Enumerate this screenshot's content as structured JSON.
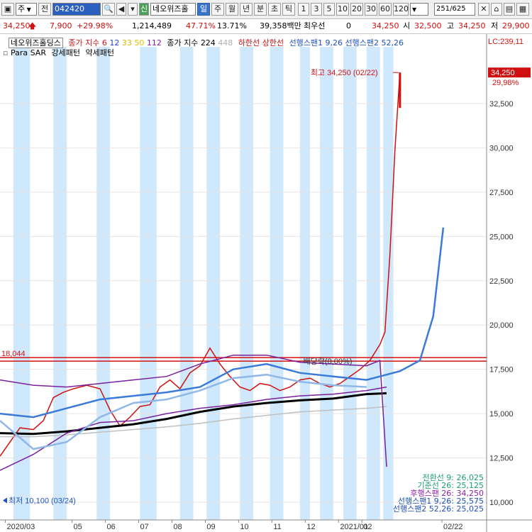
{
  "toolbar": {
    "period_type": "주",
    "prev_label": "전",
    "code": "042420",
    "new_badge": "신",
    "stock_name": "네오위즈홀",
    "periods": [
      "일",
      "주",
      "월",
      "년",
      "분",
      "초",
      "틱"
    ],
    "active_period": "일",
    "intervals": [
      "1",
      "3",
      "5",
      "10",
      "20",
      "30",
      "60",
      "120"
    ],
    "page": "251",
    "total": "/625"
  },
  "quote": {
    "price": "34,250",
    "change": "7,900",
    "change_pct": "+29.98%",
    "volume": "1,214,489",
    "ratio1": "47.71%",
    "ratio2": "13.71%",
    "amount": "39,358백만",
    "bid_label": "최우선",
    "bid_value": "0",
    "last": "34,250",
    "open_label": "시",
    "open": "32,500",
    "high_label": "고",
    "high": "34,250",
    "low_label": "저",
    "low": "29,900"
  },
  "legend": {
    "name": "네오위즈홀딩스",
    "ma_label": "종가 지수",
    "ma_periods": [
      "6",
      "12",
      "33",
      "50",
      "112"
    ],
    "ma_colors": [
      "#e0201f",
      "#1f3fd0",
      "#d7b400",
      "#e6c200",
      "#7a1fa0"
    ],
    "vol_label": "종가 지수",
    "vol_periods": [
      "224",
      "448"
    ],
    "low_line": "하한선",
    "high_line": "상한선",
    "span1": "선행스팬1 9,26",
    "span2": "선행스팬2 52,26",
    "psar": "Para SAR",
    "strong": "강세패턴",
    "weak": "약세패턴"
  },
  "chart_data": {
    "type": "candlestick",
    "title": "",
    "xlabel": "",
    "ylabel": "",
    "ylim": [
      9000,
      35700
    ],
    "y_ticks": [
      "32,500",
      "30,000",
      "27,500",
      "25,000",
      "22,500",
      "20,000",
      "17,500",
      "15,000",
      "12,500",
      "10,000"
    ],
    "y_tick_values": [
      32500,
      30000,
      27500,
      25000,
      22500,
      20000,
      17500,
      15000,
      12500,
      10000
    ],
    "x_labels": [
      "2020/03",
      "05",
      "06",
      "07",
      "08",
      "09",
      "10",
      "11",
      "12",
      "2021/01",
      "02",
      "02/22"
    ],
    "x_label_positions": [
      0.5,
      2.5,
      3.5,
      4.5,
      5.5,
      6.5,
      7.5,
      8.5,
      9.5,
      10.5,
      11.2,
      13.6
    ],
    "x_range": [
      0,
      14.6
    ],
    "last_price": "34,250",
    "last_pct": "29,98%",
    "lc_label": "LC:239,11",
    "high_annotation": "최고 34,250 (02/22)",
    "low_annotation": "최저 10,100 (03/24)",
    "hline_value": 18044,
    "hline_label": "18,044",
    "dividend_label": "배당락(0,00%)",
    "series": [
      {
        "name": "price",
        "color": "#d01010",
        "points": [
          [
            0,
            12600
          ],
          [
            0.3,
            13400
          ],
          [
            0.6,
            14200
          ],
          [
            1.0,
            14100
          ],
          [
            1.3,
            14600
          ],
          [
            1.6,
            15900
          ],
          [
            1.9,
            16200
          ],
          [
            2.2,
            16400
          ],
          [
            2.6,
            16600
          ],
          [
            3.0,
            16400
          ],
          [
            3.3,
            15200
          ],
          [
            3.6,
            14300
          ],
          [
            3.9,
            14800
          ],
          [
            4.2,
            15400
          ],
          [
            4.5,
            15500
          ],
          [
            4.8,
            16500
          ],
          [
            5.1,
            16900
          ],
          [
            5.4,
            16400
          ],
          [
            5.7,
            17300
          ],
          [
            6.0,
            17700
          ],
          [
            6.3,
            18700
          ],
          [
            6.6,
            17800
          ],
          [
            6.9,
            17100
          ],
          [
            7.2,
            16500
          ],
          [
            7.5,
            16300
          ],
          [
            7.8,
            16700
          ],
          [
            8.1,
            16600
          ],
          [
            8.4,
            16300
          ],
          [
            8.7,
            16500
          ],
          [
            9.0,
            16900
          ],
          [
            9.3,
            17000
          ],
          [
            9.6,
            16700
          ],
          [
            9.9,
            16500
          ],
          [
            10.2,
            16700
          ],
          [
            10.5,
            17100
          ],
          [
            10.8,
            17500
          ],
          [
            11.1,
            18000
          ],
          [
            11.4,
            18900
          ],
          [
            11.55,
            19600
          ],
          [
            11.7,
            24000
          ],
          [
            11.85,
            29900
          ],
          [
            12.0,
            34250
          ]
        ]
      },
      {
        "name": "",
        "color": "#000000",
        "points": [
          [
            0,
            13900
          ],
          [
            1.0,
            13850
          ],
          [
            2.0,
            14000
          ],
          [
            3.0,
            14200
          ],
          [
            4.0,
            14400
          ],
          [
            5.0,
            14700
          ],
          [
            6.0,
            15100
          ],
          [
            7.0,
            15400
          ],
          [
            8.0,
            15600
          ],
          [
            9.0,
            15750
          ],
          [
            10.0,
            15850
          ],
          [
            11.0,
            16100
          ],
          [
            11.6,
            16150
          ]
        ]
      },
      {
        "name": "",
        "color": "#c0c0c0",
        "points": [
          [
            0,
            13700
          ],
          [
            1.0,
            13700
          ],
          [
            2.0,
            13800
          ],
          [
            3.0,
            13950
          ],
          [
            4.0,
            14100
          ],
          [
            5.0,
            14250
          ],
          [
            6.0,
            14450
          ],
          [
            7.0,
            14700
          ],
          [
            8.0,
            14900
          ],
          [
            9.0,
            15100
          ],
          [
            10.0,
            15200
          ],
          [
            11.0,
            15300
          ],
          [
            11.6,
            15400
          ]
        ]
      },
      {
        "name": "",
        "color": "#7a1fa0",
        "points": [
          [
            0,
            16900
          ],
          [
            1.0,
            16600
          ],
          [
            2.0,
            16500
          ],
          [
            3.0,
            16700
          ],
          [
            4.0,
            16900
          ],
          [
            5.0,
            17100
          ],
          [
            6.0,
            17800
          ],
          [
            7.0,
            18300
          ],
          [
            8.0,
            18300
          ],
          [
            9.0,
            17900
          ],
          [
            10.0,
            17800
          ],
          [
            11.0,
            17700
          ],
          [
            11.4,
            18000
          ],
          [
            11.6,
            12000
          ]
        ]
      },
      {
        "name": "",
        "color": "#7a1fa0",
        "points": [
          [
            0,
            11800
          ],
          [
            1.0,
            12700
          ],
          [
            2.0,
            13900
          ],
          [
            3.0,
            14500
          ],
          [
            4.0,
            14600
          ],
          [
            5.0,
            15000
          ],
          [
            6.0,
            15300
          ],
          [
            7.0,
            15500
          ],
          [
            8.0,
            15800
          ],
          [
            9.0,
            16000
          ],
          [
            10.0,
            16100
          ],
          [
            11.0,
            16300
          ],
          [
            11.6,
            16500
          ]
        ]
      },
      {
        "name": "선행스팬1 9,26",
        "color": "#3a7ad9",
        "points": [
          [
            0,
            15000
          ],
          [
            1.0,
            14800
          ],
          [
            2.0,
            15300
          ],
          [
            3.0,
            15800
          ],
          [
            4.0,
            16000
          ],
          [
            5.0,
            16200
          ],
          [
            6.0,
            16500
          ],
          [
            7.0,
            17500
          ],
          [
            8.0,
            17800
          ],
          [
            9.0,
            17300
          ],
          [
            10.0,
            17100
          ],
          [
            11.0,
            16900
          ],
          [
            11.6,
            17200
          ],
          [
            12.0,
            17400
          ],
          [
            12.6,
            18000
          ],
          [
            13.0,
            20500
          ],
          [
            13.3,
            25500
          ]
        ]
      },
      {
        "name": "선행스팬2 52,26",
        "color": "#8fb8e8",
        "points": [
          [
            0,
            14600
          ],
          [
            1.0,
            13000
          ],
          [
            2.0,
            13400
          ],
          [
            3.0,
            14800
          ],
          [
            4.0,
            15600
          ],
          [
            5.0,
            15800
          ],
          [
            6.0,
            16300
          ],
          [
            7.0,
            17000
          ],
          [
            8.0,
            17200
          ],
          [
            9.0,
            16800
          ],
          [
            10.0,
            16600
          ],
          [
            11.0,
            16500
          ]
        ]
      }
    ],
    "ichimoku_values": [
      {
        "label": "전환선 9: 26,025",
        "color": "#1aa070"
      },
      {
        "label": "기준선 26: 25,125",
        "color": "#1aa070"
      },
      {
        "label": "후행스팬 26: 34,250",
        "color": "#9020a0"
      },
      {
        "label": "선행스팬1 9,26: 25,575",
        "color": "#1f50c0"
      },
      {
        "label": "선행스팬2 52,26: 25,025",
        "color": "#1f50c0"
      }
    ]
  }
}
